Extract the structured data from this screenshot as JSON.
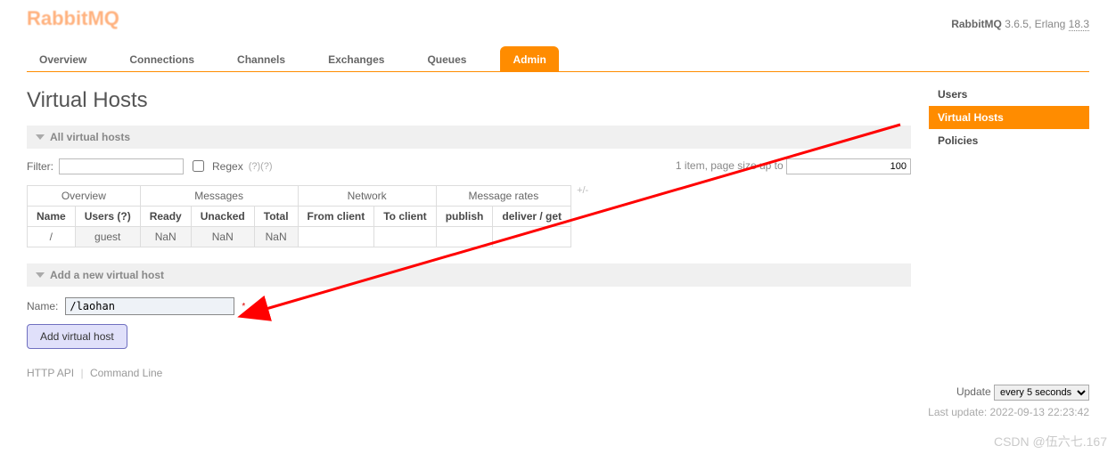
{
  "header": {
    "logo": "RabbitMQ",
    "product": "RabbitMQ",
    "version": "3.6.5",
    "erlang_label": "Erlang",
    "erlang_version": "18.3"
  },
  "tabs": [
    "Overview",
    "Connections",
    "Channels",
    "Exchanges",
    "Queues",
    "Admin"
  ],
  "tabs_selected": 5,
  "page_title": "Virtual Hosts",
  "sidebar": {
    "items": [
      "Users",
      "Virtual Hosts",
      "Policies"
    ],
    "selected": 1
  },
  "sections": {
    "all_vhosts_title": "All virtual hosts",
    "add_vhost_title": "Add a new virtual host"
  },
  "filter": {
    "label": "Filter:",
    "value": "",
    "regex_label": "Regex",
    "hint": "(?)(?)",
    "count_text": "1 item, page size up to",
    "page_size": "100"
  },
  "table": {
    "groups": [
      "Overview",
      "Messages",
      "Network",
      "Message rates"
    ],
    "group_spans": [
      2,
      3,
      2,
      2
    ],
    "plusminus": "+/-",
    "cols": [
      "Name",
      "Users (?)",
      "Ready",
      "Unacked",
      "Total",
      "From client",
      "To client",
      "publish",
      "deliver / get"
    ],
    "row": {
      "name": "/",
      "users": "guest",
      "ready": "NaN",
      "unacked": "NaN",
      "total": "NaN",
      "from_client": "",
      "to_client": "",
      "publish": "",
      "deliver_get": ""
    }
  },
  "add_form": {
    "name_label": "Name:",
    "name_value": "/laohan",
    "button": "Add virtual host"
  },
  "footer": {
    "api": "HTTP API",
    "cli": "Command Line"
  },
  "update": {
    "label": "Update",
    "option": "every 5 seconds",
    "last": "Last update: 2022-09-13 22:23:42"
  },
  "watermark": "CSDN @伍六七.167"
}
